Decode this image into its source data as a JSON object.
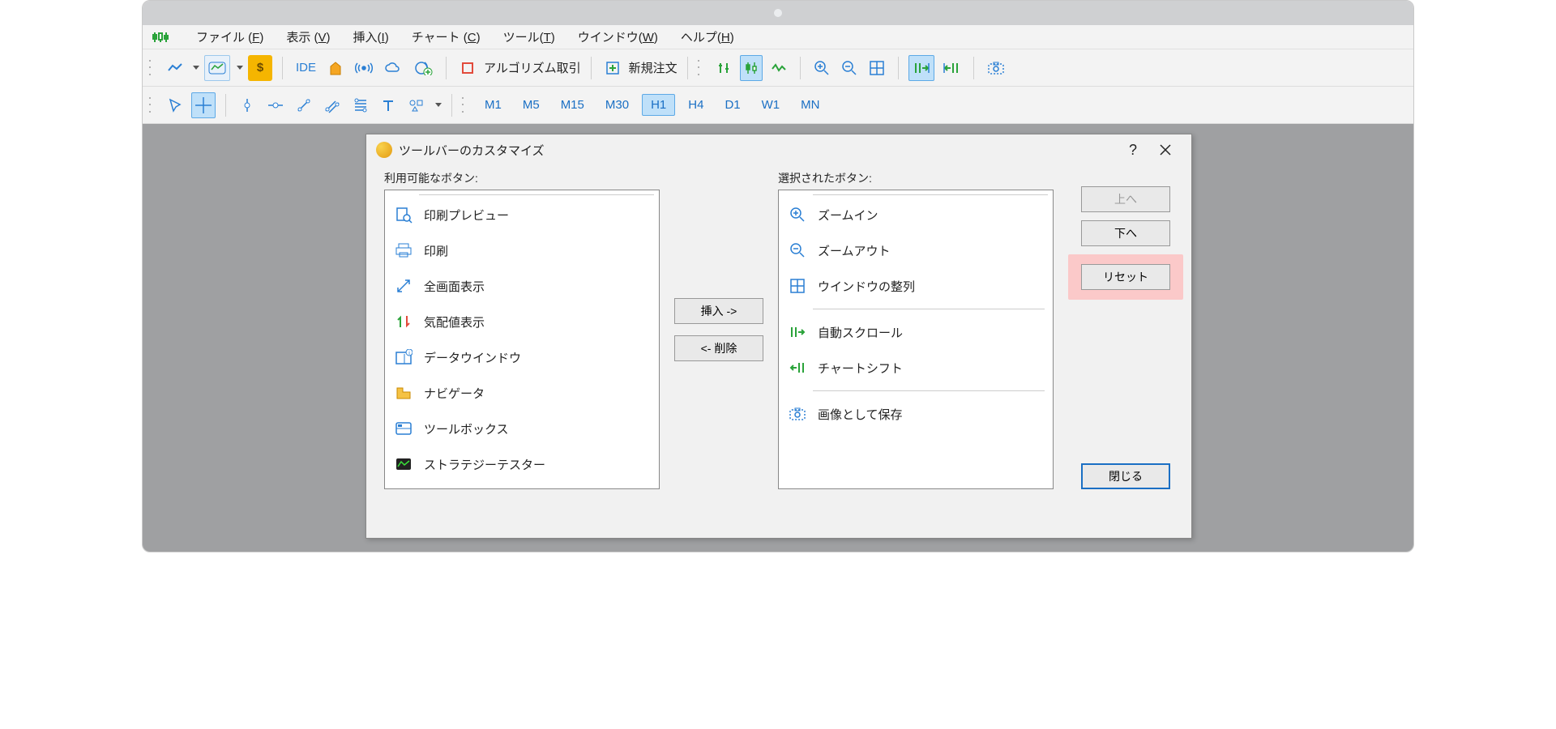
{
  "menubar": {
    "items": [
      {
        "label": "ファイル (F)",
        "u": "F"
      },
      {
        "label": "表示 (V)",
        "u": "V"
      },
      {
        "label": "挿入(I)",
        "u": "I"
      },
      {
        "label": "チャート (C)",
        "u": "C"
      },
      {
        "label": "ツール(T)",
        "u": "T"
      },
      {
        "label": "ウインドウ(W)",
        "u": "W"
      },
      {
        "label": "ヘルプ(H)",
        "u": "H"
      }
    ]
  },
  "toolbar1": {
    "ide": "IDE",
    "algo": "アルゴリズム取引",
    "neworder": "新規注文"
  },
  "timeframes": [
    "M1",
    "M5",
    "M15",
    "M30",
    "H1",
    "H4",
    "D1",
    "W1",
    "MN"
  ],
  "tf_active": "H1",
  "dialog": {
    "title": "ツールバーのカスタマイズ",
    "help": "?",
    "available_label": "利用可能なボタン:",
    "selected_label": "選択されたボタン:",
    "available": [
      {
        "icon": "preview",
        "label": "印刷プレビュー"
      },
      {
        "icon": "print",
        "label": "印刷"
      },
      {
        "icon": "fullscreen",
        "label": "全画面表示"
      },
      {
        "icon": "quotes",
        "label": "気配値表示"
      },
      {
        "icon": "datawin",
        "label": "データウインドウ"
      },
      {
        "icon": "navigator",
        "label": "ナビゲータ"
      },
      {
        "icon": "toolbox",
        "label": "ツールボックス"
      },
      {
        "icon": "tester",
        "label": "ストラテジーテスター"
      }
    ],
    "selected": [
      {
        "icon": "zoomin",
        "label": "ズームイン"
      },
      {
        "icon": "zoomout",
        "label": "ズームアウト"
      },
      {
        "icon": "tile",
        "label": "ウインドウの整列"
      },
      {
        "sep": true
      },
      {
        "icon": "autoscroll",
        "label": "自動スクロール"
      },
      {
        "icon": "chartshift",
        "label": "チャートシフト"
      },
      {
        "sep": true
      },
      {
        "icon": "saveimg",
        "label": "画像として保存"
      }
    ],
    "btn_insert": "挿入 ->",
    "btn_remove": "<- 削除",
    "btn_up": "上へ",
    "btn_down": "下へ",
    "btn_reset": "リセット",
    "btn_close": "閉じる"
  }
}
